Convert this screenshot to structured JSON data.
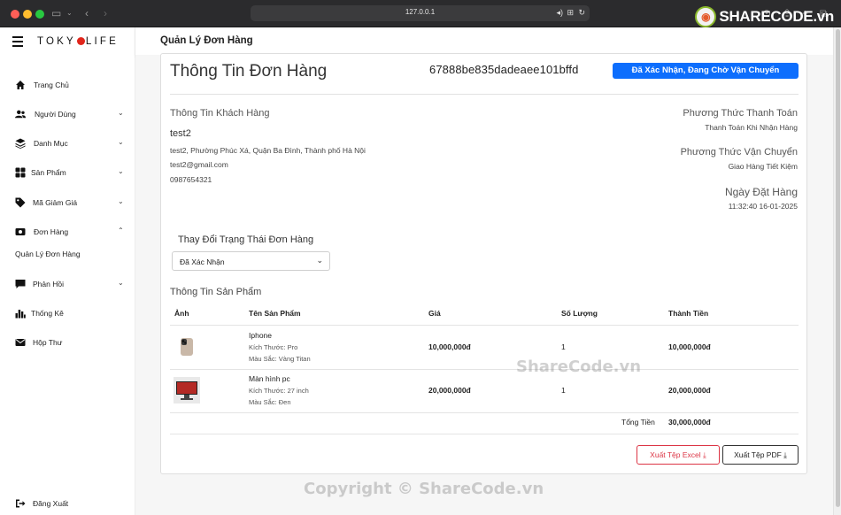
{
  "browser": {
    "url": "127.0.0.1",
    "brand_logo": "SHARECODE.vn"
  },
  "sidebar": {
    "brand": {
      "left": "TOKY",
      "right": "LIFE"
    },
    "items": [
      {
        "label": "Trang Chủ",
        "icon": "home-icon"
      },
      {
        "label": "Người Dùng",
        "icon": "users-icon",
        "expandable": true
      },
      {
        "label": "Danh Mục",
        "icon": "layers-icon",
        "expandable": true
      },
      {
        "label": "Sản Phẩm",
        "icon": "grid-icon",
        "expandable": true
      },
      {
        "label": "Mã Giảm Giá",
        "icon": "tag-icon",
        "expandable": true
      },
      {
        "label": "Đơn Hàng",
        "icon": "orders-icon",
        "expandable": true,
        "expanded": true
      },
      {
        "label": "Phản Hồi",
        "icon": "comment-icon",
        "expandable": true
      },
      {
        "label": "Thống Kê",
        "icon": "chart-icon"
      },
      {
        "label": "Hộp Thư",
        "icon": "envelope-icon"
      }
    ],
    "subitem": "Quản Lý Đơn Hàng",
    "logout": "Đăng Xuất"
  },
  "header": {
    "title": "Quản Lý Đơn Hàng"
  },
  "order": {
    "title": "Thông Tin Đơn Hàng",
    "id": "67888be835dadeaee101bffd",
    "status_badge": "Đã Xác Nhận, Đang Chờ Vận Chuyển",
    "status_color": "#0d6efd"
  },
  "customer": {
    "heading": "Thông Tin Khách Hàng",
    "name": "test2",
    "address": "test2, Phường Phúc Xá, Quận Ba Đình, Thành phố Hà Nội",
    "email": "test2@gmail.com",
    "phone": "0987654321"
  },
  "payment": {
    "heading": "Phương Thức Thanh Toán",
    "value": "Thanh Toán Khi Nhận Hàng"
  },
  "shipping": {
    "heading": "Phương Thức Vận Chuyển",
    "value": "Giao Hàng Tiết Kiệm"
  },
  "date": {
    "heading": "Ngày Đặt Hàng",
    "value": "11:32:40 16-01-2025"
  },
  "status_change": {
    "label": "Thay Đổi Trạng Thái Đơn Hàng",
    "selected": "Đã Xác Nhận"
  },
  "products": {
    "heading": "Thông Tin Sản Phẩm",
    "columns": [
      "Ảnh",
      "Tên Sản Phẩm",
      "Giá",
      "Số Lượng",
      "Thành Tiền"
    ],
    "rows": [
      {
        "name": "Iphone",
        "size": "Kích Thước: Pro",
        "color": "Màu Sắc: Vàng Titan",
        "price": "10,000,000đ",
        "qty": "1",
        "total": "10,000,000đ"
      },
      {
        "name": "Màn hình pc",
        "size": "Kích Thước: 27 inch",
        "color": "Màu Sắc: Đen",
        "price": "20,000,000đ",
        "qty": "1",
        "total": "20,000,000đ"
      }
    ],
    "total_label": "Tổng Tiền",
    "total_value": "30,000,000đ"
  },
  "actions": {
    "excel": "Xuất Tệp Excel",
    "pdf": "Xuất Tệp PDF"
  },
  "watermarks": {
    "center": "ShareCode.vn",
    "bottom": "Copyright © ShareCode.vn"
  }
}
